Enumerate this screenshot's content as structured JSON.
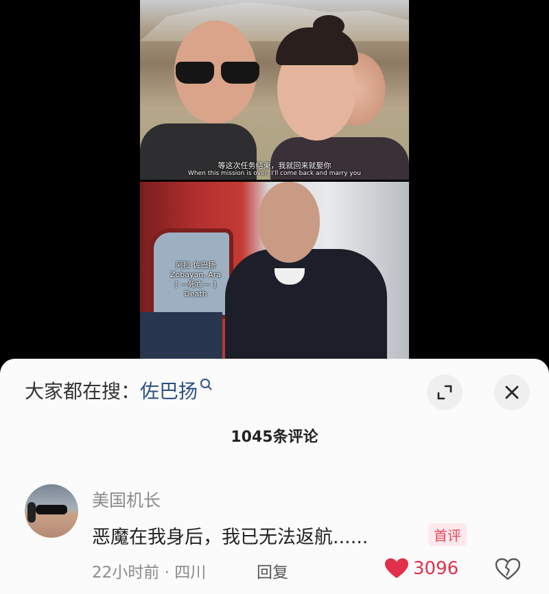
{
  "video": {
    "subtitle_cn": "等这次任务结束，我就回来就娶你",
    "subtitle_en": "When this mission is over, I'll come back and marry you",
    "death_label": {
      "name_cn": "阿拉 佐巴扬",
      "name_en": "Zobayan, Ara",
      "status_cn": "[ —死亡— ]",
      "status_en": "Death"
    }
  },
  "search_bar": {
    "prefix": "大家都在搜：",
    "term": "佐巴扬",
    "icon": "search-icon"
  },
  "buttons": {
    "expand_icon": "expand-icon",
    "close_icon": "close-icon"
  },
  "comments": {
    "count_label": "1045条评论",
    "items": [
      {
        "username": "美国机长",
        "text": "恶魔在我身后，我已无法返航......",
        "badge": "首评",
        "time_location": "22小时前 · 四川",
        "reply_label": "回复",
        "likes": "3096"
      }
    ]
  },
  "colors": {
    "accent_red": "#e0304a",
    "link_blue": "#2b4f83",
    "sheet_bg": "#fbfbfb"
  }
}
